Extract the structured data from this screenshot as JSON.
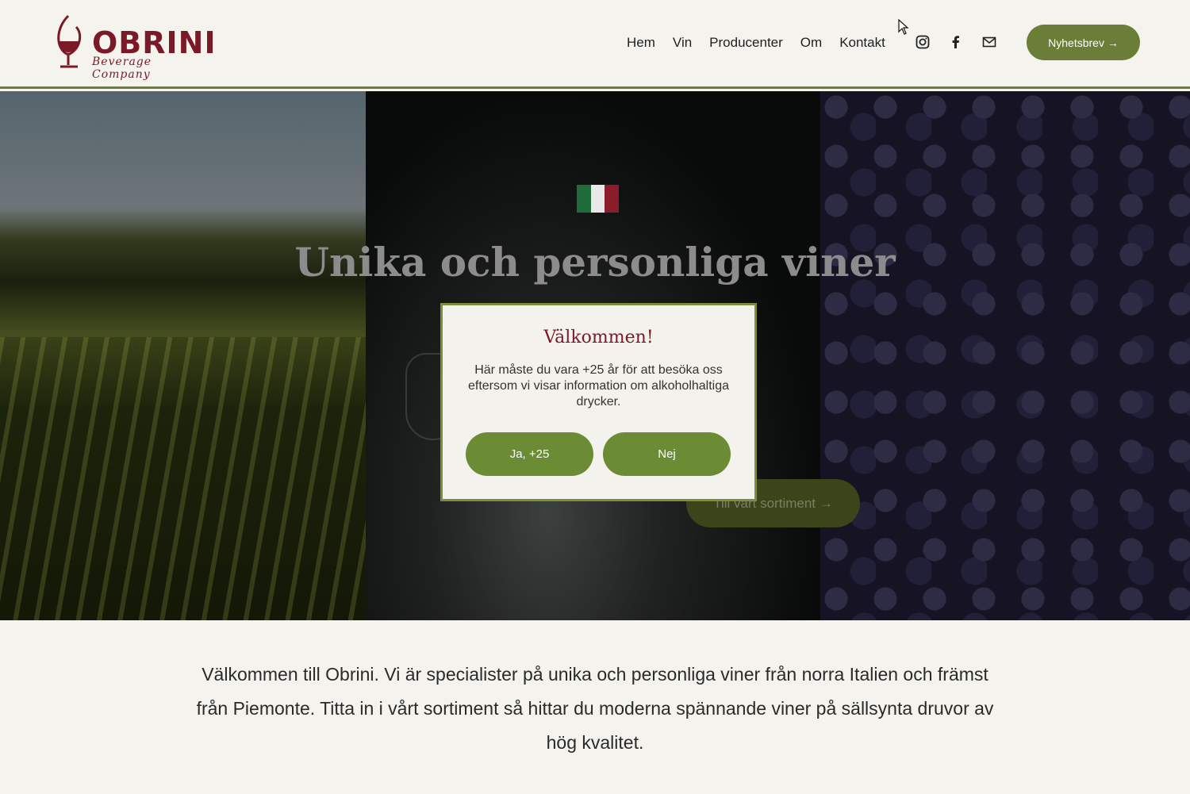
{
  "brand": {
    "name": "OBRINI",
    "tagline": "Beverage Company"
  },
  "nav": [
    "Hem",
    "Vin",
    "Producenter",
    "Om",
    "Kontakt"
  ],
  "socials": [
    "instagram-icon",
    "facebook-icon",
    "mail-icon"
  ],
  "header_button": "Nyhetsbrev →",
  "hero": {
    "title": "Unika och personliga viner",
    "button": "Till vårt sortiment →",
    "flag_colors": [
      "#1f6b3a",
      "#e9e9e9",
      "#8b1d2a"
    ]
  },
  "intro": "Välkommen till Obrini. Vi är specialister på unika och personliga viner från norra Italien och främst från Piemonte. Titta in i vårt sortiment så hittar du moderna spännande viner på sällsynta druvor av hög kvalitet.",
  "modal": {
    "title": "Välkommen!",
    "text": "Här måste du vara +25 år för att besöka oss eftersom vi visar information om alkoholhaltiga drycker.",
    "yes": "Ja, +25",
    "no": "Nej"
  },
  "colors": {
    "accent": "#6b7d36",
    "brand": "#7a1a26"
  }
}
